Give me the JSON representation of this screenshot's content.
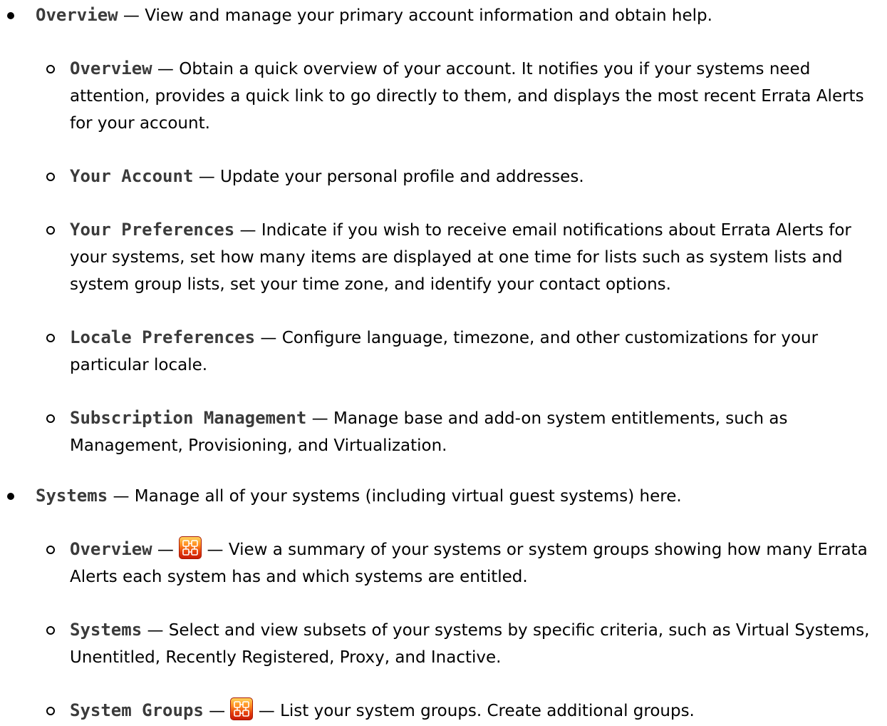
{
  "sections": [
    {
      "term": "Overview",
      "dash": " — ",
      "desc": "View and manage your primary account information and obtain help.",
      "items": [
        {
          "term": "Overview",
          "dash": " — ",
          "desc": "Obtain a quick overview of your account. It notifies you if your systems need attention, provides a quick link to go directly to them, and displays the most recent Errata Alerts for your account."
        },
        {
          "term": "Your Account",
          "dash": " — ",
          "desc": "Update your personal profile and addresses."
        },
        {
          "term": "Your Preferences",
          "dash": " — ",
          "desc": "Indicate if you wish to receive email notifications about Errata Alerts for your systems, set how many items are displayed at one time for lists such as system lists and system group lists, set your time zone, and identify your contact options."
        },
        {
          "term": "Locale Preferences",
          "dash": " — ",
          "desc": "Configure language, timezone, and other customizations for your particular locale."
        },
        {
          "term": "Subscription Management",
          "dash": " — ",
          "desc": "Manage base and add-on system entitlements, such as Management, Provisioning, and Virtualization."
        }
      ]
    },
    {
      "term": "Systems",
      "dash": " — ",
      "desc": "Manage all of your systems (including virtual guest systems) here.",
      "items": [
        {
          "term": "Overview",
          "dash": " — ",
          "dash2": " — ",
          "icon": "management-entitlement-icon",
          "desc": "View a summary of your systems or system groups showing how many Errata Alerts each system has and which systems are entitled."
        },
        {
          "term": "Systems",
          "dash": " — ",
          "desc": "Select and view subsets of your systems by specific criteria, such as Virtual Systems, Unentitled, Recently Registered, Proxy, and Inactive."
        },
        {
          "term": "System Groups",
          "dash": " — ",
          "dash2": " — ",
          "icon": "management-entitlement-icon",
          "desc": "List your system groups. Create additional groups."
        }
      ]
    }
  ],
  "icon_colors": {
    "top": "#ffd35a",
    "mid": "#ff8a1e",
    "bottom": "#c91a05"
  }
}
